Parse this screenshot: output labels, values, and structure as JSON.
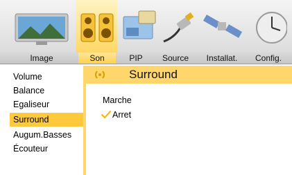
{
  "tabs": [
    {
      "label": "Image",
      "icon": "landscape-monitor-icon"
    },
    {
      "label": "Son",
      "icon": "speakers-icon",
      "active": true
    },
    {
      "label": "PIP",
      "icon": "pip-screens-icon"
    },
    {
      "label": "Source",
      "icon": "cable-plug-icon"
    },
    {
      "label": "Installat.",
      "icon": "satellite-icon"
    },
    {
      "label": "Config.",
      "icon": "clock-icon"
    }
  ],
  "menu": {
    "items": [
      {
        "label": "Volume"
      },
      {
        "label": "Balance"
      },
      {
        "label": "Egaliseur"
      },
      {
        "label": "Surround",
        "selected": true
      },
      {
        "label": "Augum.Basses"
      },
      {
        "label": "Écouteur"
      }
    ]
  },
  "panel": {
    "title": "Surround",
    "options": [
      {
        "label": "Marche",
        "checked": false
      },
      {
        "label": "Arret",
        "checked": true
      }
    ]
  },
  "colors": {
    "accent": "#ffc93c",
    "panel": "#ffd66b",
    "check": "#ffb000"
  }
}
